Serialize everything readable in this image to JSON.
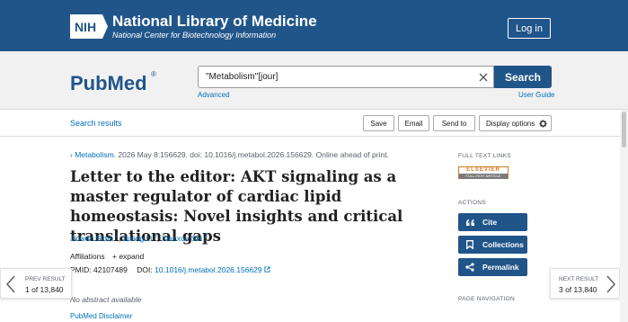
{
  "header": {
    "nih_logo_text": "NIH",
    "title": "National Library of Medicine",
    "subtitle": "National Center for Biotechnology Information",
    "login_label": "Log in"
  },
  "search": {
    "logo_text": "PubMed",
    "logo_mark": "®",
    "query": "\"Metabolism\"[jour]",
    "search_label": "Search",
    "advanced_label": "Advanced",
    "user_guide_label": "User Guide"
  },
  "toolbar": {
    "results_label": "Search results",
    "save_label": "Save",
    "email_label": "Email",
    "send_to_label": "Send to",
    "display_options_label": "Display options"
  },
  "article": {
    "journal_name": "Metabolism.",
    "citation": "2026 May 8:156629. doi: 10.1016/j.metabol.2026.156629. Online ahead of print.",
    "title": "Letter to the editor: AKT signaling as a master regulator of cardiac lipid homeostasis: Novel insights and critical translational gaps",
    "authors": [
      {
        "name": "Jinwen Sima",
        "sup": "1"
      },
      {
        "name": "Suling Li",
        "sup": "2"
      },
      {
        "name": "Xianxue Shi",
        "sup": "3"
      }
    ],
    "affiliations_label": "Affiliations",
    "expand_label": "expand",
    "pmid_label": "PMID:",
    "pmid": "42107489",
    "doi_label": "DOI:",
    "doi": "10.1016/j.metabol.2026.156629",
    "abstract_note": "No abstract available",
    "disclaimer_label": "PubMed Disclaimer"
  },
  "sidebar": {
    "full_text_heading": "FULL TEXT LINKS",
    "elsevier_logo": "ELSEVIER",
    "elsevier_sub": "FULL-TEXT ARTICLE",
    "actions_heading": "ACTIONS",
    "cite_label": "Cite",
    "collections_label": "Collections",
    "permalink_label": "Permalink",
    "page_nav_heading": "PAGE NAVIGATION"
  },
  "pager": {
    "prev_label": "PREV RESULT",
    "prev_count": "1 of 13,840",
    "next_label": "NEXT RESULT",
    "next_count": "3 of 13,840"
  },
  "colors": {
    "brand_blue": "#20558a",
    "link_blue": "#0071bc",
    "elsevier_orange": "#e0701e"
  }
}
